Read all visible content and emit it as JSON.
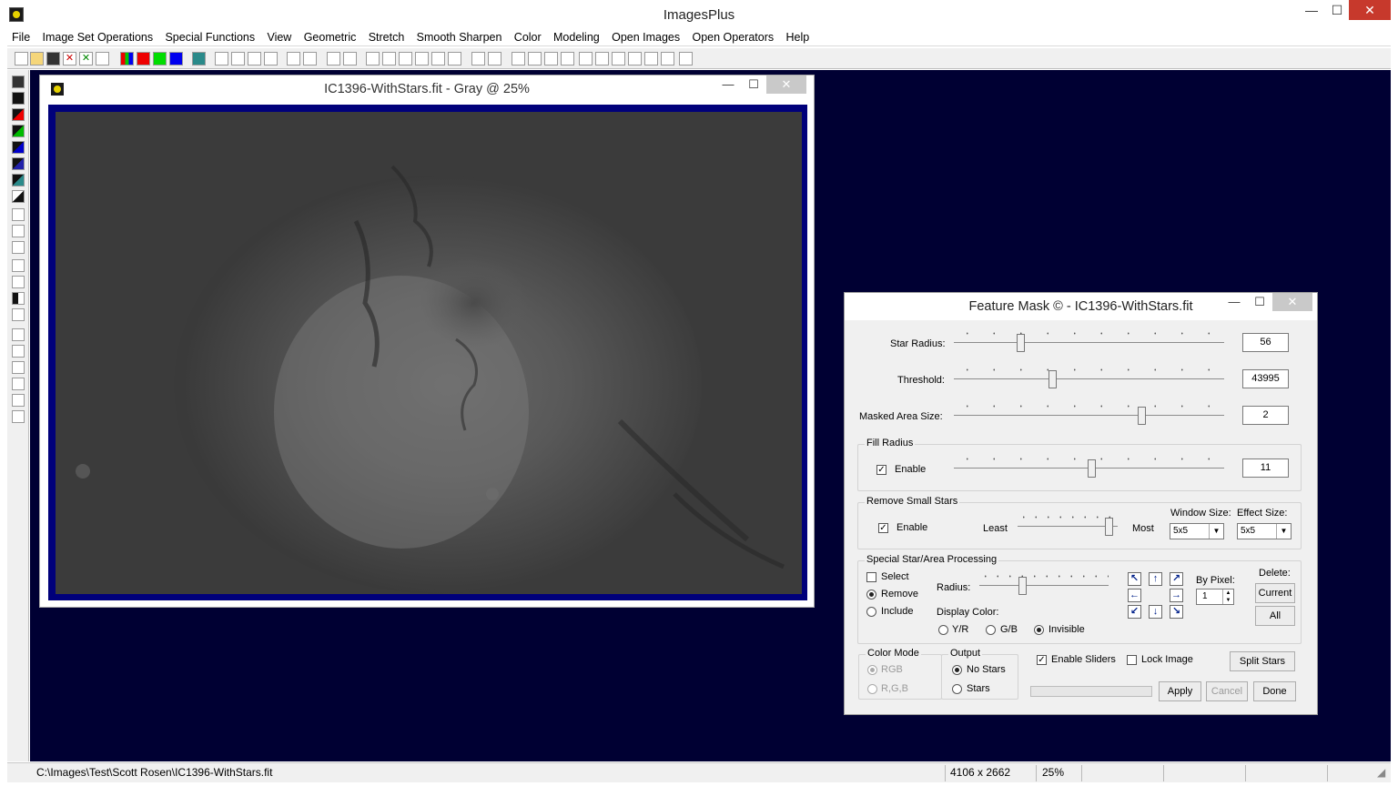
{
  "app": {
    "title": "ImagesPlus",
    "min": "—",
    "max": "☐",
    "close": "✕"
  },
  "menu": [
    "File",
    "Image Set Operations",
    "Special Functions",
    "View",
    "Geometric",
    "Stretch",
    "Smooth Sharpen",
    "Color",
    "Modeling",
    "Open Images",
    "Open Operators",
    "Help"
  ],
  "image_window": {
    "title": "IC1396-WithStars.fit - Gray @ 25%",
    "min": "—",
    "max": "☐",
    "close": "✕"
  },
  "statusbar": {
    "path": "C:\\Images\\Test\\Scott Rosen\\IC1396-WithStars.fit",
    "dimensions": "4106 x 2662",
    "zoom": "25%"
  },
  "dialog": {
    "title": "Feature Mask © - IC1396-WithStars.fit",
    "min": "—",
    "max": "☐",
    "close": "✕",
    "star_radius": {
      "label": "Star Radius:",
      "value": "56",
      "position": 0.24
    },
    "threshold": {
      "label": "Threshold:",
      "value": "43995",
      "position": 0.36
    },
    "masked_area": {
      "label": "Masked Area Size:",
      "value": "2",
      "position": 0.7
    },
    "fill_radius": {
      "group": "Fill Radius",
      "enable": "Enable",
      "enabled": true,
      "value": "11",
      "position": 0.51
    },
    "remove_small": {
      "group": "Remove Small Stars",
      "enable": "Enable",
      "enabled": true,
      "least": "Least",
      "most": "Most",
      "position": 0.95,
      "window_size_label": "Window Size:",
      "window_size": "5x5",
      "effect_size_label": "Effect Size:",
      "effect_size": "5x5"
    },
    "special": {
      "group": "Special Star/Area Processing",
      "select": "Select",
      "remove": "Remove",
      "include": "Include",
      "radius_label": "Radius:",
      "radius_position": 0.32,
      "display_color": "Display Color:",
      "yr": "Y/R",
      "gb": "G/B",
      "invisible": "Invisible",
      "by_pixel": "By Pixel:",
      "by_pixel_value": "1",
      "delete": "Delete:",
      "current": "Current",
      "all": "All",
      "arrows": [
        "↖",
        "↑",
        "↗",
        "←",
        "→",
        "↙",
        "↓",
        "↘"
      ]
    },
    "color_mode": {
      "group": "Color Mode",
      "rgb": "RGB",
      "r_g_b": "R,G,B"
    },
    "output": {
      "group": "Output",
      "no_stars": "No Stars",
      "stars": "Stars"
    },
    "enable_sliders": "Enable Sliders",
    "lock_image": "Lock Image",
    "split_stars": "Split Stars",
    "apply": "Apply",
    "cancel": "Cancel",
    "done": "Done",
    "check_mark": "✓"
  },
  "colors": {
    "desktop": "#000033",
    "image_frame": "#00007a",
    "close_red": "#c7392c"
  }
}
